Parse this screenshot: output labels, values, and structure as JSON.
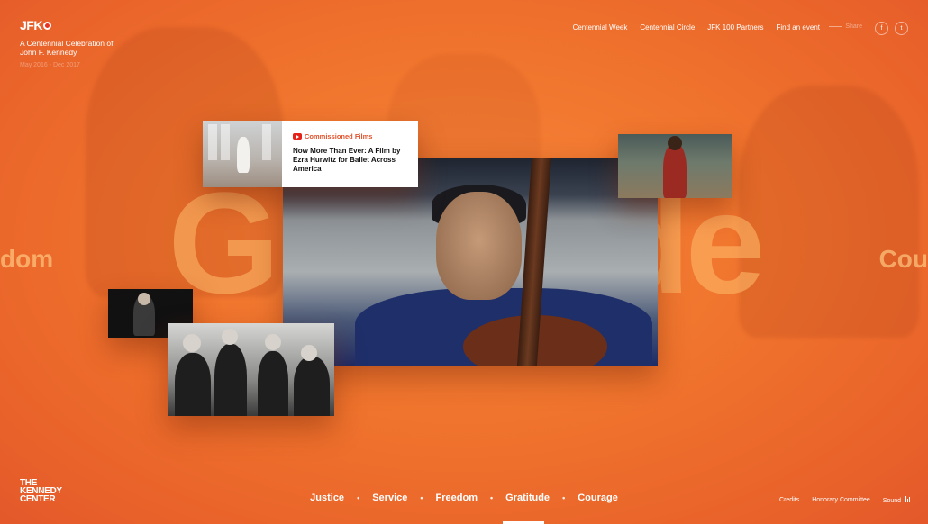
{
  "header": {
    "logo": "JFK",
    "tagline": "A Centennial Celebration of John F. Kennedy",
    "dates": "May 2016 - Dec 2017",
    "nav": [
      "Centennial Week",
      "Centennial Circle",
      "JFK 100 Partners",
      "Find an event"
    ],
    "share_label": "Share",
    "social": [
      {
        "name": "facebook-icon",
        "glyph": "f"
      },
      {
        "name": "twitter-icon",
        "glyph": "t"
      }
    ]
  },
  "hero": {
    "big_word": "Gratitude",
    "left_word": "dom",
    "right_word": "Cou"
  },
  "feature_card": {
    "tag": "Commissioned Films",
    "title": "Now More Than Ever: A Film by Ezra Hurwitz for Ballet Across America"
  },
  "footer": {
    "org_logo": [
      "THE",
      "KENNEDY",
      "CENTER"
    ],
    "themes": [
      "Justice",
      "Service",
      "Freedom",
      "Gratitude",
      "Courage"
    ],
    "active_theme": "Gratitude",
    "links": [
      "Credits",
      "Honorary Committee",
      "Sound"
    ]
  },
  "colors": {
    "accent": "#f0742d",
    "logo_dot": "#e63323",
    "film_tag": "#e0532d"
  }
}
